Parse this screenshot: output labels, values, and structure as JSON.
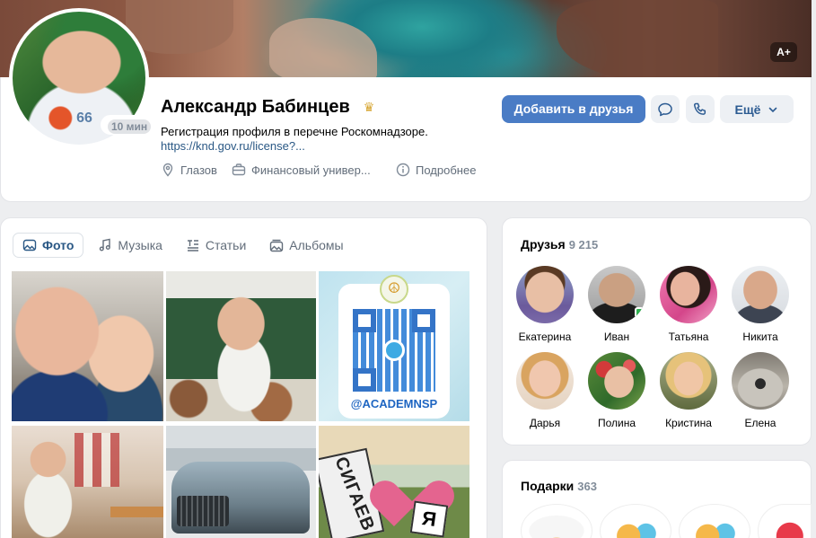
{
  "cover": {
    "badge": "A+"
  },
  "profile": {
    "name": "Александр Бабинцев",
    "last_seen": "10 мин",
    "status": "Регистрация профиля в перечне Роскомнадзоре.",
    "status_link": "https://knd.gov.ru/license?...",
    "city": "Глазов",
    "education": "Финансовый универ...",
    "more_info": "Подробнее",
    "avatar_shirt_text": "66"
  },
  "actions": {
    "add_friend": "Добавить в друзья",
    "more": "Ещё"
  },
  "photo_tabs": [
    {
      "label": "Фото",
      "icon": "photo-icon",
      "active": true
    },
    {
      "label": "Музыка",
      "icon": "music-icon",
      "active": false
    },
    {
      "label": "Статьи",
      "icon": "articles-icon",
      "active": false
    },
    {
      "label": "Альбомы",
      "icon": "albums-icon",
      "active": false
    }
  ],
  "photos": {
    "qr_caption": "@ACADEMNSP",
    "sign_text": "СИГАЕВ",
    "sign_letter": "Я"
  },
  "friends": {
    "title": "Друзья",
    "count": "9 215",
    "items": [
      {
        "name": "Екатерина"
      },
      {
        "name": "Иван"
      },
      {
        "name": "Татьяна"
      },
      {
        "name": "Никита"
      },
      {
        "name": "Дарья"
      },
      {
        "name": "Полина"
      },
      {
        "name": "Кристина"
      },
      {
        "name": "Елена"
      }
    ]
  },
  "gifts": {
    "title": "Подарки",
    "count": "363"
  },
  "colors": {
    "accent": "#4a7cc5",
    "link": "#2a5885",
    "muted": "#818c99",
    "background": "#edeef0"
  }
}
